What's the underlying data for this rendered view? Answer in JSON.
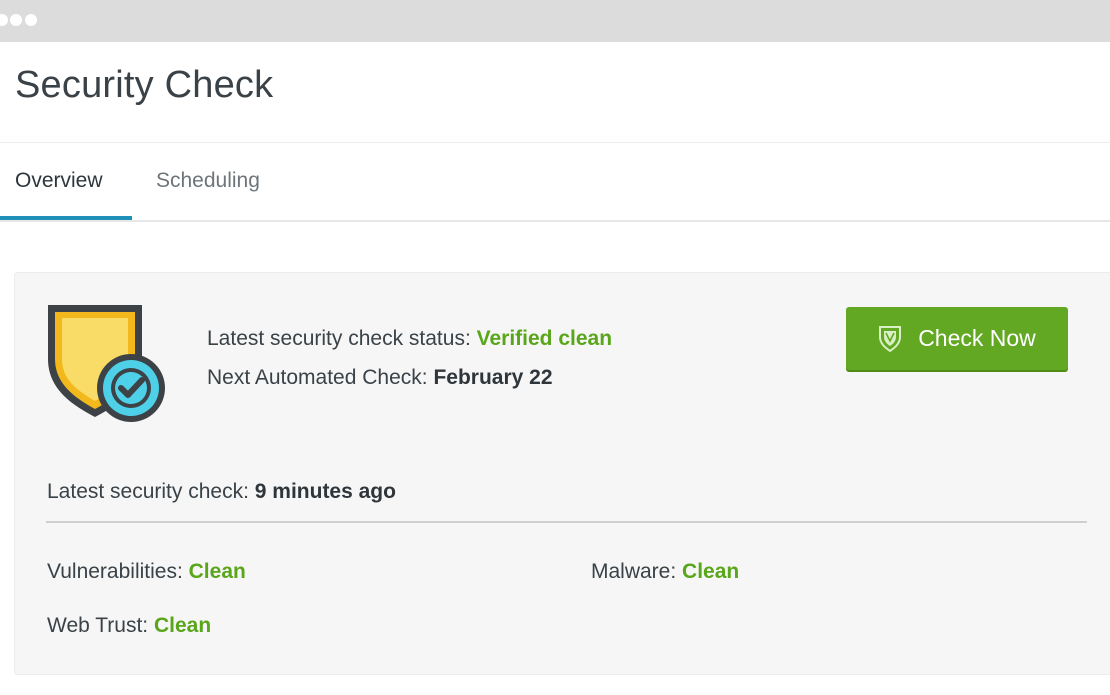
{
  "window": {
    "controls": [
      "window-dot",
      "window-dot",
      "window-dot"
    ]
  },
  "header": {
    "title": "Security Check"
  },
  "tabs": [
    {
      "label": "Overview",
      "active": true
    },
    {
      "label": "Scheduling",
      "active": false
    }
  ],
  "overview": {
    "icon": "shield-check-icon",
    "status": {
      "label": "Latest security check status:",
      "value": "Verified clean"
    },
    "next_check": {
      "label": "Next Automated Check:",
      "value": "February 22"
    },
    "check_now": {
      "label": "Check Now",
      "icon": "shield-icon"
    },
    "latest_check": {
      "label": "Latest security check:",
      "value": "9 minutes ago"
    },
    "results": {
      "vulnerabilities": {
        "label": "Vulnerabilities:",
        "value": "Clean"
      },
      "malware": {
        "label": "Malware:",
        "value": "Clean"
      },
      "web_trust": {
        "label": "Web Trust:",
        "value": "Clean"
      }
    }
  },
  "colors": {
    "accent": "#1f90b8",
    "success": "#5aa61a",
    "button": "#62a822",
    "shield_fill": "#f7d24a",
    "shield_outline": "#3d4247",
    "badge": "#4dd0e8"
  }
}
